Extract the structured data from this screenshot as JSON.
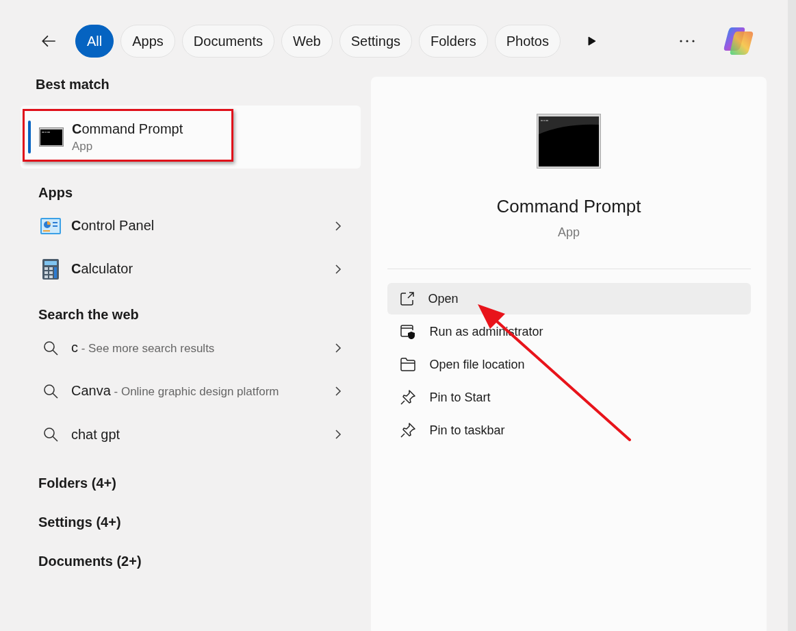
{
  "filters": [
    {
      "label": "All",
      "selected": true
    },
    {
      "label": "Apps",
      "selected": false
    },
    {
      "label": "Documents",
      "selected": false
    },
    {
      "label": "Web",
      "selected": false
    },
    {
      "label": "Settings",
      "selected": false
    },
    {
      "label": "Folders",
      "selected": false
    },
    {
      "label": "Photos",
      "selected": false
    }
  ],
  "best_match": {
    "heading": "Best match",
    "title": "**C**ommand Prompt",
    "subtitle": "App",
    "selected": true
  },
  "apps": {
    "heading": "Apps",
    "items": [
      {
        "kind": "control-panel",
        "label": "**C**ontrol Panel"
      },
      {
        "kind": "calculator",
        "label": "**C**alculator"
      }
    ]
  },
  "web": {
    "heading": "Search the web",
    "items": [
      {
        "query": "c",
        "detail": " - See more search results"
      },
      {
        "query": "Canva",
        "detail": " - Online graphic design platform"
      },
      {
        "query": "chat gpt"
      }
    ]
  },
  "sections": [
    "Folders (4+)",
    "Settings (4+)",
    "Documents (2+)"
  ],
  "preview": {
    "title": "Command Prompt",
    "subtitle": "App",
    "actions": [
      {
        "kind": "open",
        "label": "Open",
        "selected": true
      },
      {
        "kind": "admin",
        "label": "Run as administrator",
        "selected": false
      },
      {
        "kind": "folder",
        "label": "Open file location",
        "selected": false
      },
      {
        "kind": "pin",
        "label": "Pin to Start",
        "selected": false
      },
      {
        "kind": "pin",
        "label": "Pin to taskbar",
        "selected": false
      }
    ]
  }
}
